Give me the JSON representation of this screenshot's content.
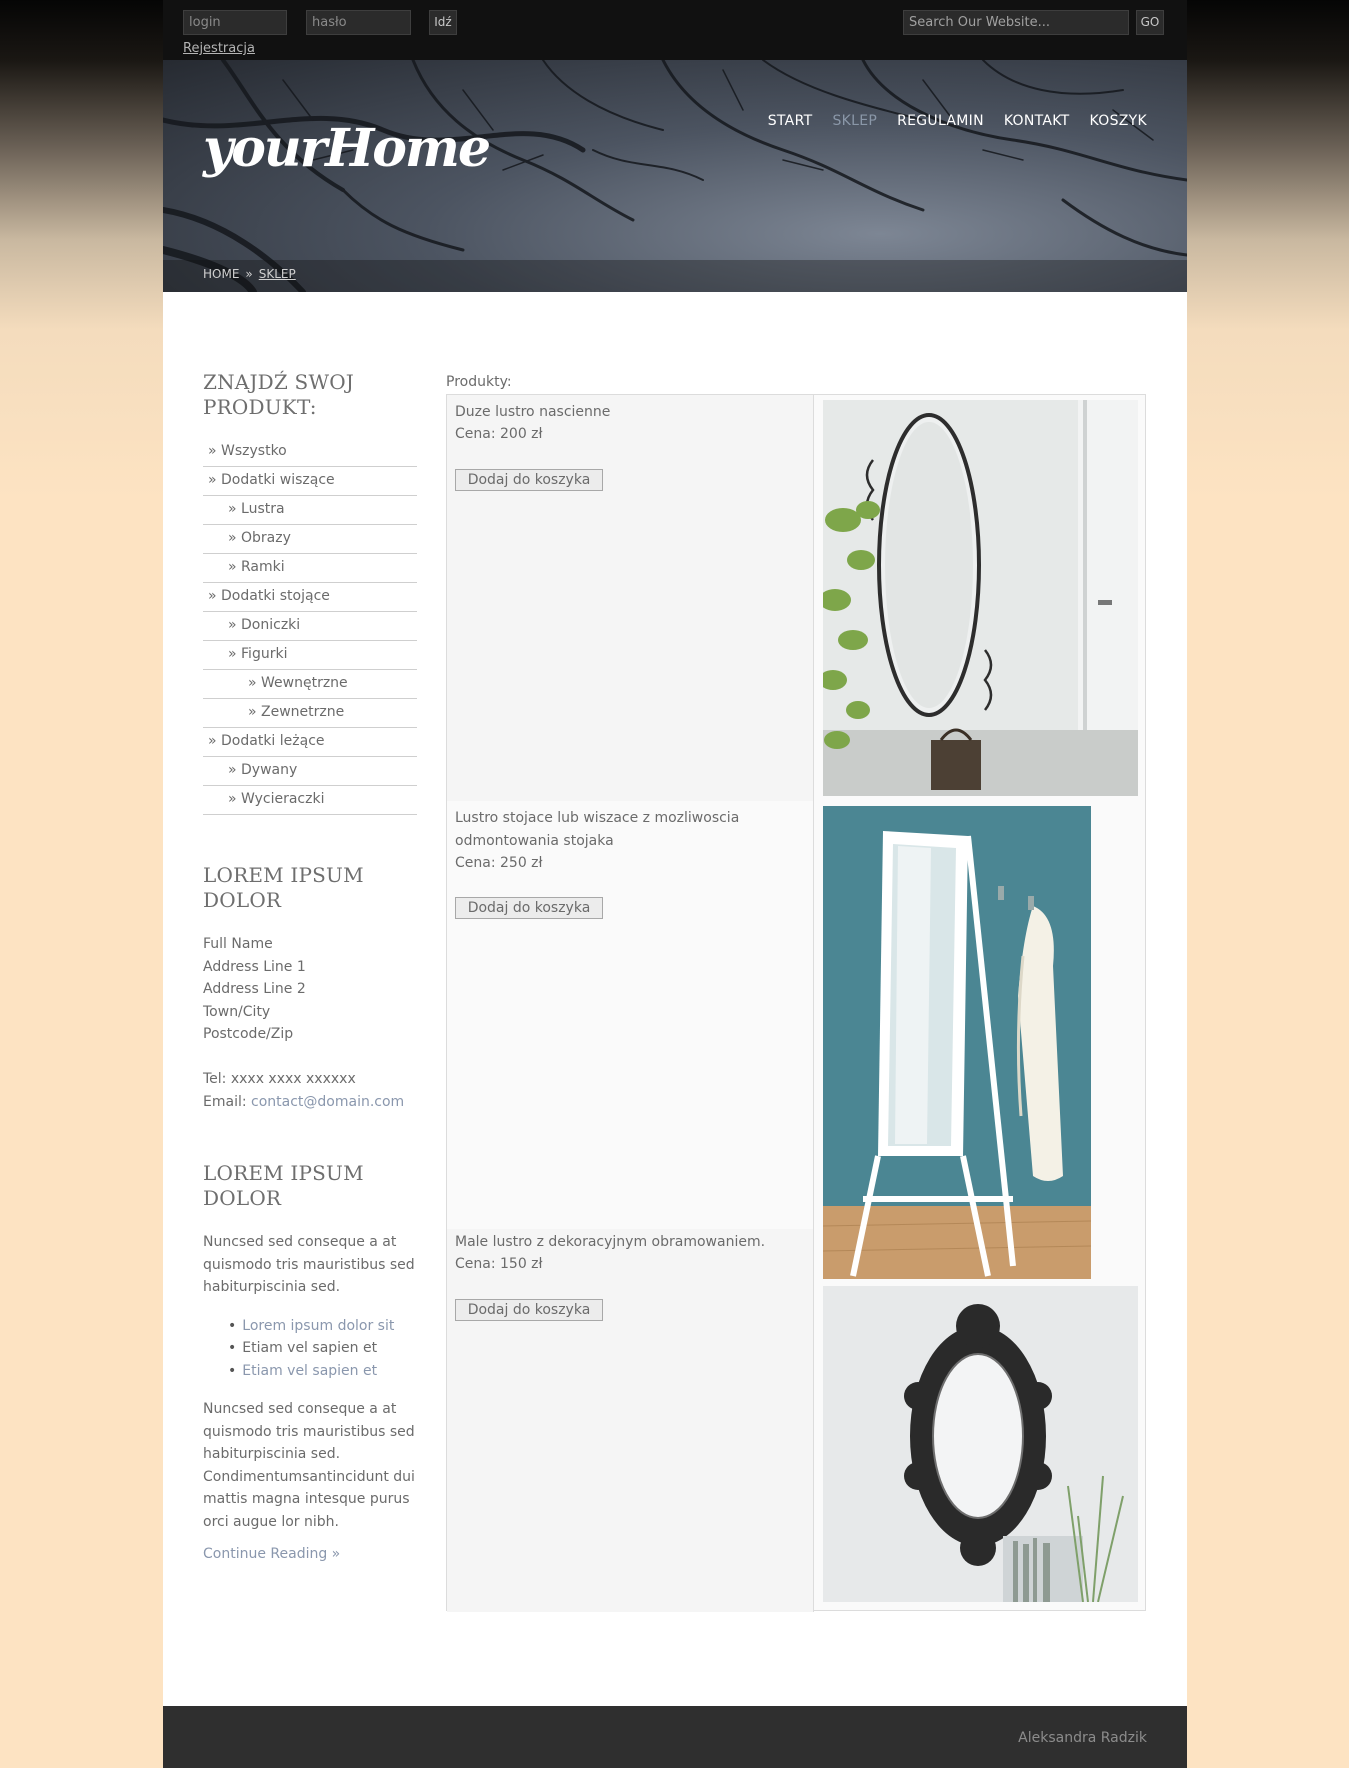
{
  "login": {
    "login_placeholder": "login",
    "password_placeholder": "hasło",
    "submit": "Idź",
    "register": "Rejestracja"
  },
  "search": {
    "placeholder": "Search Our Website...",
    "button": "GO"
  },
  "header": {
    "logo": "yourHome",
    "nav": [
      "START",
      "SKLEP",
      "REGULAMIN",
      "KONTAKT",
      "KOSZYK"
    ],
    "active_nav": "SKLEP",
    "breadcrumb": {
      "home": "HOME",
      "separator": "»",
      "current": "SKLEP"
    }
  },
  "sidebar": {
    "categories_title": "ZNAJDŹ SWOJ PRODUKT:",
    "categories": [
      {
        "label": "» Wszystko",
        "level": 1
      },
      {
        "label": "» Dodatki wiszące",
        "level": 1
      },
      {
        "label": "» Lustra",
        "level": 2
      },
      {
        "label": "» Obrazy",
        "level": 2
      },
      {
        "label": "» Ramki",
        "level": 2
      },
      {
        "label": "» Dodatki stojące",
        "level": 1
      },
      {
        "label": "» Doniczki",
        "level": 2
      },
      {
        "label": "» Figurki",
        "level": 2
      },
      {
        "label": "» Wewnętrzne",
        "level": 3
      },
      {
        "label": "» Zewnetrzne",
        "level": 3
      },
      {
        "label": "» Dodatki leżące",
        "level": 1
      },
      {
        "label": "» Dywany",
        "level": 2
      },
      {
        "label": "» Wycieraczki",
        "level": 2
      }
    ],
    "contact_title": "LOREM IPSUM DOLOR",
    "address": [
      "Full Name",
      "Address Line 1",
      "Address Line 2",
      "Town/City",
      "Postcode/Zip"
    ],
    "tel": "Tel: xxxx xxxx xxxxxx",
    "email_label": "Email: ",
    "email": "contact@domain.com",
    "info_title": "LOREM IPSUM DOLOR",
    "paragraph1": "Nuncsed sed conseque a at quismodo tris mauristibus sed habiturpiscinia sed.",
    "bullets": [
      {
        "text": "Lorem ipsum dolor sit",
        "link": true
      },
      {
        "text": "Etiam vel sapien et",
        "link": false
      },
      {
        "text": "Etiam vel sapien et",
        "link": true
      }
    ],
    "paragraph2": "Nuncsed sed conseque a at quismodo tris mauristibus sed habiturpiscinia sed. Condimentumsantincidunt dui mattis magna intesque purus orci augue lor nibh.",
    "continue": "Continue Reading »"
  },
  "products": {
    "label": "Produkty:",
    "items": [
      {
        "name": "Duze lustro nascienne",
        "price": "Cena: 200 zł",
        "button": "Dodaj do koszyka",
        "image": "wall-oval-mirror-photo"
      },
      {
        "name": "Lustro stojace lub wiszace z mozliwoscia odmontowania stojaka",
        "price": "Cena: 250 zł",
        "button": "Dodaj do koszyka",
        "image": "standing-mirror-photo"
      },
      {
        "name": "Male lustro z dekoracyjnym obramowaniem.",
        "price": "Cena: 150 zł",
        "button": "Dodaj do koszyka",
        "image": "ornate-mirror-photo"
      }
    ]
  },
  "footer": {
    "author": "Aleksandra Radzik"
  }
}
